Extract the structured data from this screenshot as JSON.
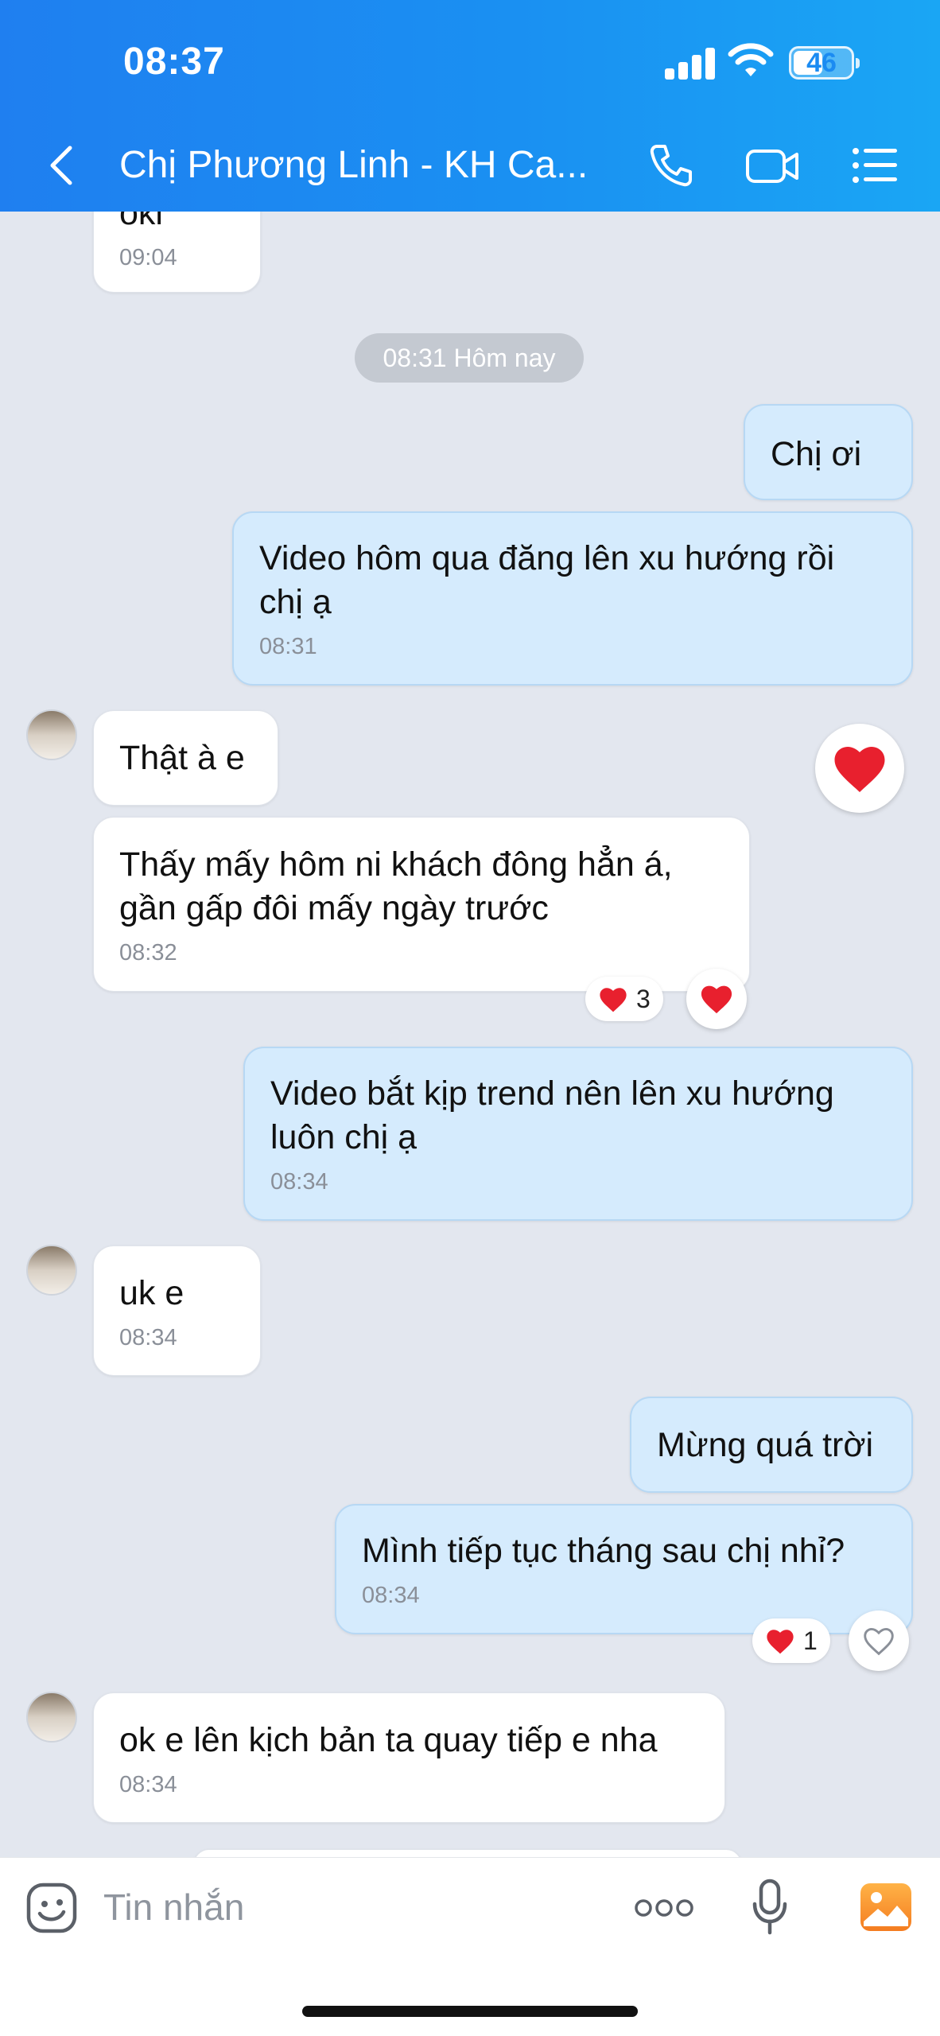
{
  "status": {
    "time": "08:37",
    "battery": "46"
  },
  "header": {
    "title": "Chị Phương Linh - KH Ca..."
  },
  "date_divider": "08:31 Hôm nay",
  "messages": [
    {
      "text": "oki",
      "time": "09:04"
    },
    {
      "text": "Chị ơi",
      "time": ""
    },
    {
      "text": "Video hôm qua đăng lên xu hướng rồi chị ạ",
      "time": "08:31"
    },
    {
      "text": "Thật à e",
      "time": ""
    },
    {
      "text": "Thấy mấy hôm ni khách đông hẳn á, gần gấp đôi mấy ngày trước",
      "time": "08:32",
      "reaction_count": "3"
    },
    {
      "text": "Video bắt kịp trend nên lên xu hướng luôn chị ạ",
      "time": "08:34"
    },
    {
      "text": "uk e",
      "time": "08:34"
    },
    {
      "text": "Mừng quá trời",
      "time": ""
    },
    {
      "text": "Mình tiếp tục tháng sau chị nhỉ?",
      "time": "08:34",
      "reaction_count": "1"
    },
    {
      "text": "ok e lên kịch bản ta quay tiếp e nha",
      "time": "08:34"
    }
  ],
  "input": {
    "placeholder": "Tin nhắn"
  },
  "colors": {
    "header": "#1f86f1",
    "bubble_out": "#d5ebfd",
    "bubble_in": "#ffffff",
    "heart": "#e8202e"
  }
}
